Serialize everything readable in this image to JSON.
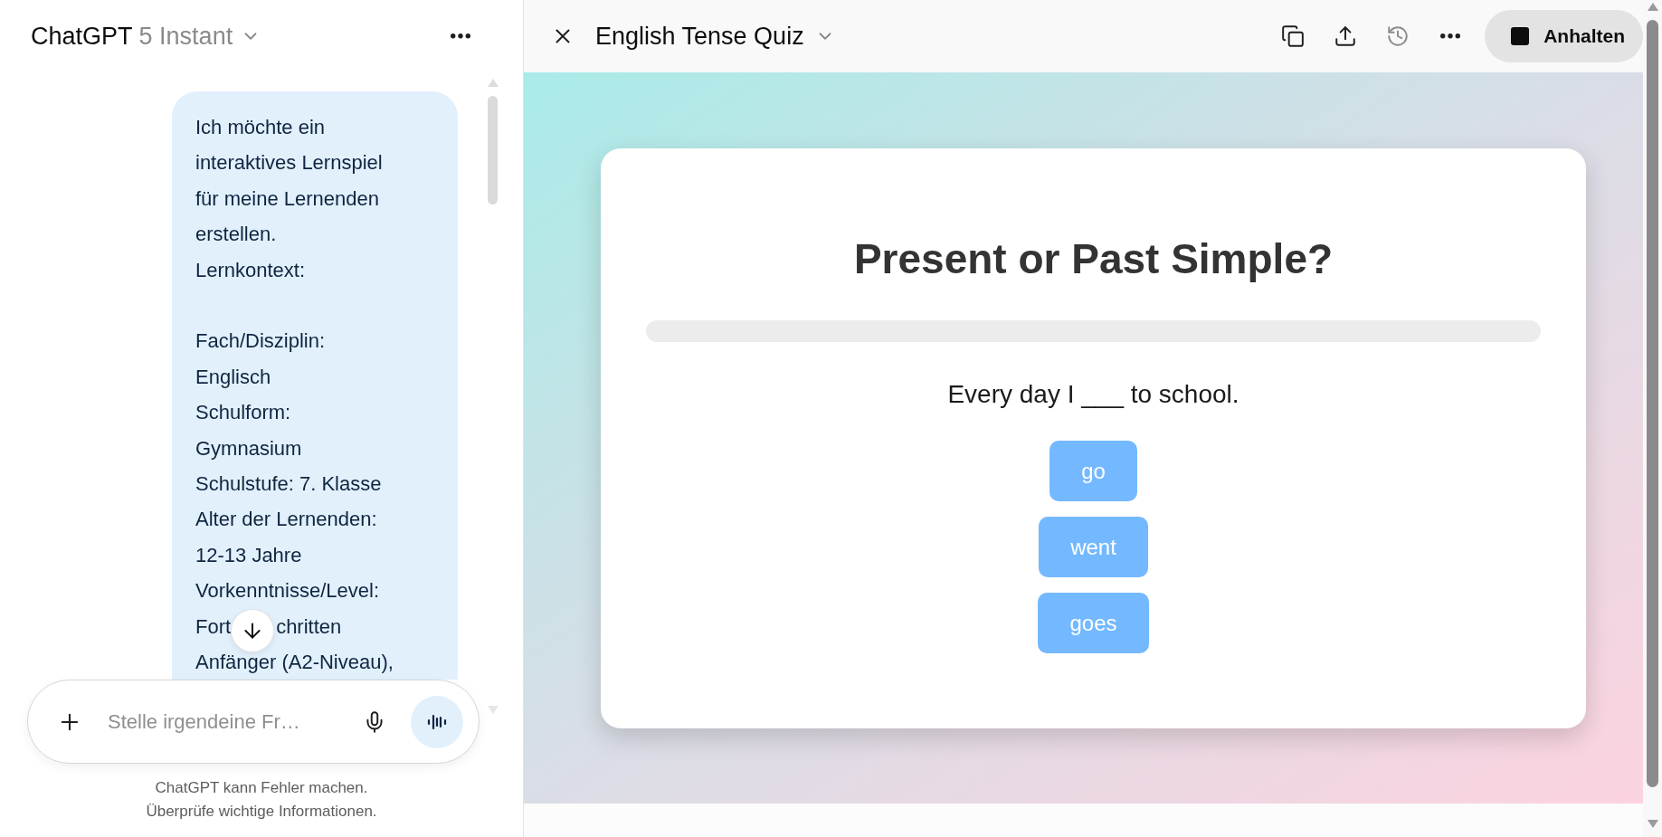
{
  "chat_panel": {
    "model_selector": {
      "name": "ChatGPT",
      "version": "5 Instant"
    },
    "message": {
      "segments": [
        {
          "kind": "text",
          "lines": [
            "Ich möchte ein",
            "interaktives Lernspiel",
            "für meine Lernenden",
            "erstellen.",
            "Lernkontext:"
          ]
        },
        {
          "kind": "blank"
        },
        {
          "kind": "text",
          "lines": [
            "Fach/Disziplin:",
            "Englisch",
            "Schulform:",
            "Gymnasium",
            "Schulstufe: 7. Klasse",
            "Alter der Lernenden:",
            "12-13 Jahre",
            "Vorkenntnisse/Level:"
          ]
        },
        {
          "kind": "covered",
          "parts": [
            "Fort",
            "chritten"
          ]
        },
        {
          "kind": "text",
          "lines": [
            "Anfänger (A2-Niveau),"
          ]
        }
      ]
    },
    "composer": {
      "placeholder": "Stelle irgendeine Fr…"
    },
    "disclaimer": [
      "ChatGPT kann Fehler machen.",
      "Überprüfe wichtige Informationen."
    ]
  },
  "canvas": {
    "title": "English Tense Quiz",
    "actions": [
      {
        "disabled": false
      },
      {
        "disabled": false
      },
      {
        "disabled": true
      },
      {
        "disabled": false
      }
    ],
    "stop_button": {
      "label": "Anhalten"
    },
    "quiz": {
      "title": "Present or Past Simple?",
      "progress": {
        "level": 0
      },
      "question": "Every day I ___ to school.",
      "options": [
        "go",
        "went",
        "goes"
      ]
    }
  }
}
